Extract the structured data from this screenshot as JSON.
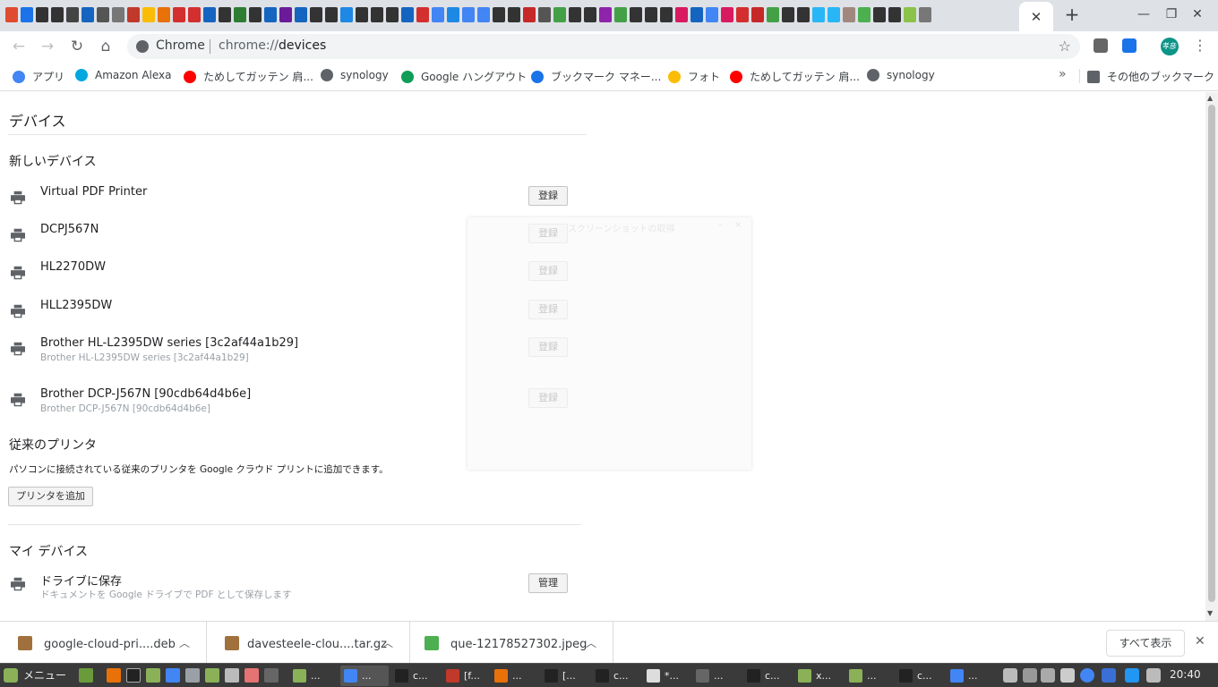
{
  "tabs": {
    "active_close": "✕",
    "new_tab": "+",
    "favicon_colors": [
      "#e04b2f",
      "#1a73e8",
      "#333",
      "#333",
      "#444",
      "#1565c0",
      "#555",
      "#777",
      "#c0392b",
      "#fbbc05",
      "#e8710a",
      "#d32f2f",
      "#d32f2f",
      "#1565c0",
      "#333",
      "#2e7d32",
      "#333",
      "#1565c0",
      "#6a1b9a",
      "#1565c0",
      "#333",
      "#333",
      "#1e88e5",
      "#333",
      "#333",
      "#333",
      "#1565c0",
      "#d32f2f",
      "#4285f4",
      "#1e88e5",
      "#4285f4",
      "#4285f4",
      "#333",
      "#333",
      "#c62828",
      "#555",
      "#43a047",
      "#333",
      "#333",
      "#8e24aa",
      "#43a047",
      "#333",
      "#333",
      "#333",
      "#d81b60",
      "#1565c0",
      "#4285f4",
      "#d81b60",
      "#d32f2f",
      "#c62828",
      "#43a047",
      "#333",
      "#333",
      "#29b6f6",
      "#29b6f6",
      "#a1887f",
      "#4caf50",
      "#333",
      "#333",
      "#8bc34a",
      "#777"
    ]
  },
  "window": {
    "minimize": "—",
    "restore": "❐",
    "close": "✕"
  },
  "toolbar": {
    "back": "←",
    "forward": "→",
    "reload": "↻",
    "home": "⌂",
    "site_chip": "Chrome",
    "url_scheme": "chrome://",
    "url_host": "devices",
    "star": "☆",
    "avatar_text": "孝彦",
    "menu": "⋮"
  },
  "bookmarks": {
    "items": [
      {
        "label": "アプリ",
        "icon": "apps-icon",
        "color": "#4285f4"
      },
      {
        "label": "Amazon Alexa",
        "icon": "alexa-icon",
        "color": "#00a8e1"
      },
      {
        "label": "ためしてガッテン 肩...",
        "icon": "youtube-icon",
        "color": "#ff0000"
      },
      {
        "label": "synology",
        "icon": "globe-icon",
        "color": "#5f6368"
      },
      {
        "label": "Google ハングアウト",
        "icon": "hangouts-icon",
        "color": "#0f9d58"
      },
      {
        "label": "ブックマーク マネー...",
        "icon": "star-icon",
        "color": "#1a73e8"
      },
      {
        "label": "フォト",
        "icon": "photos-icon",
        "color": "#fbbc05"
      },
      {
        "label": "ためしてガッテン 肩...",
        "icon": "youtube-icon",
        "color": "#ff0000"
      },
      {
        "label": "synology",
        "icon": "globe-icon",
        "color": "#5f6368"
      }
    ],
    "more": "»",
    "other": "その他のブックマーク"
  },
  "page": {
    "title": "デバイス",
    "new_devices_heading": "新しいデバイス",
    "register_label": "登録",
    "new_devices": [
      {
        "name": "Virtual PDF Printer",
        "sub": ""
      },
      {
        "name": "DCPJ567N",
        "sub": ""
      },
      {
        "name": "HL2270DW",
        "sub": ""
      },
      {
        "name": "HLL2395DW",
        "sub": ""
      },
      {
        "name": "Brother HL-L2395DW series [3c2af44a1b29]",
        "sub": "Brother HL-L2395DW series [3c2af44a1b29]"
      },
      {
        "name": "Brother DCP-J567N [90cdb64d4b6e]",
        "sub": "Brother DCP-J567N [90cdb64d4b6e]"
      }
    ],
    "classic_heading": "従来のプリンタ",
    "classic_desc": "パソコンに接続されている従来のプリンタを Google クラウド プリントに追加できます。",
    "add_printer": "プリンタを追加",
    "my_devices_heading": "マイ デバイス",
    "my_device": {
      "name": "ドライブに保存",
      "sub": "ドキュメントを Google ドライブで PDF として保存します"
    },
    "manage_label": "管理",
    "ghost_title": "スクリーンショットの取得",
    "ghost_min": "–",
    "ghost_close": "×"
  },
  "downloads": {
    "items": [
      {
        "name": "google-cloud-pri....deb",
        "icon": "package-icon",
        "color": "#a0713c"
      },
      {
        "name": "davesteele-clou....tar.gz",
        "icon": "package-icon",
        "color": "#a0713c"
      },
      {
        "name": "que-12178527302.jpeg",
        "icon": "image-icon",
        "color": "#4caf50"
      }
    ],
    "chevron": "︿",
    "show_all": "すべて表示",
    "close": "✕"
  },
  "taskbar": {
    "menu_label": "メニュー",
    "windows": [
      {
        "label": "...",
        "color": "#8bb158"
      },
      {
        "label": "...",
        "color": "#4285f4"
      },
      {
        "label": "c...",
        "color": "#222"
      },
      {
        "label": "[f...",
        "color": "#c0392b"
      },
      {
        "label": "...",
        "color": "#e8710a"
      },
      {
        "label": "[...",
        "color": "#222"
      },
      {
        "label": "c...",
        "color": "#222"
      },
      {
        "label": "*...",
        "color": "#ddd"
      },
      {
        "label": "...",
        "color": "#666"
      },
      {
        "label": "c...",
        "color": "#222"
      },
      {
        "label": "x...",
        "color": "#8bb158"
      },
      {
        "label": "...",
        "color": "#8bb158"
      },
      {
        "label": "c...",
        "color": "#222"
      },
      {
        "label": "...",
        "color": "#4285f4"
      }
    ],
    "clock": "20:40"
  }
}
